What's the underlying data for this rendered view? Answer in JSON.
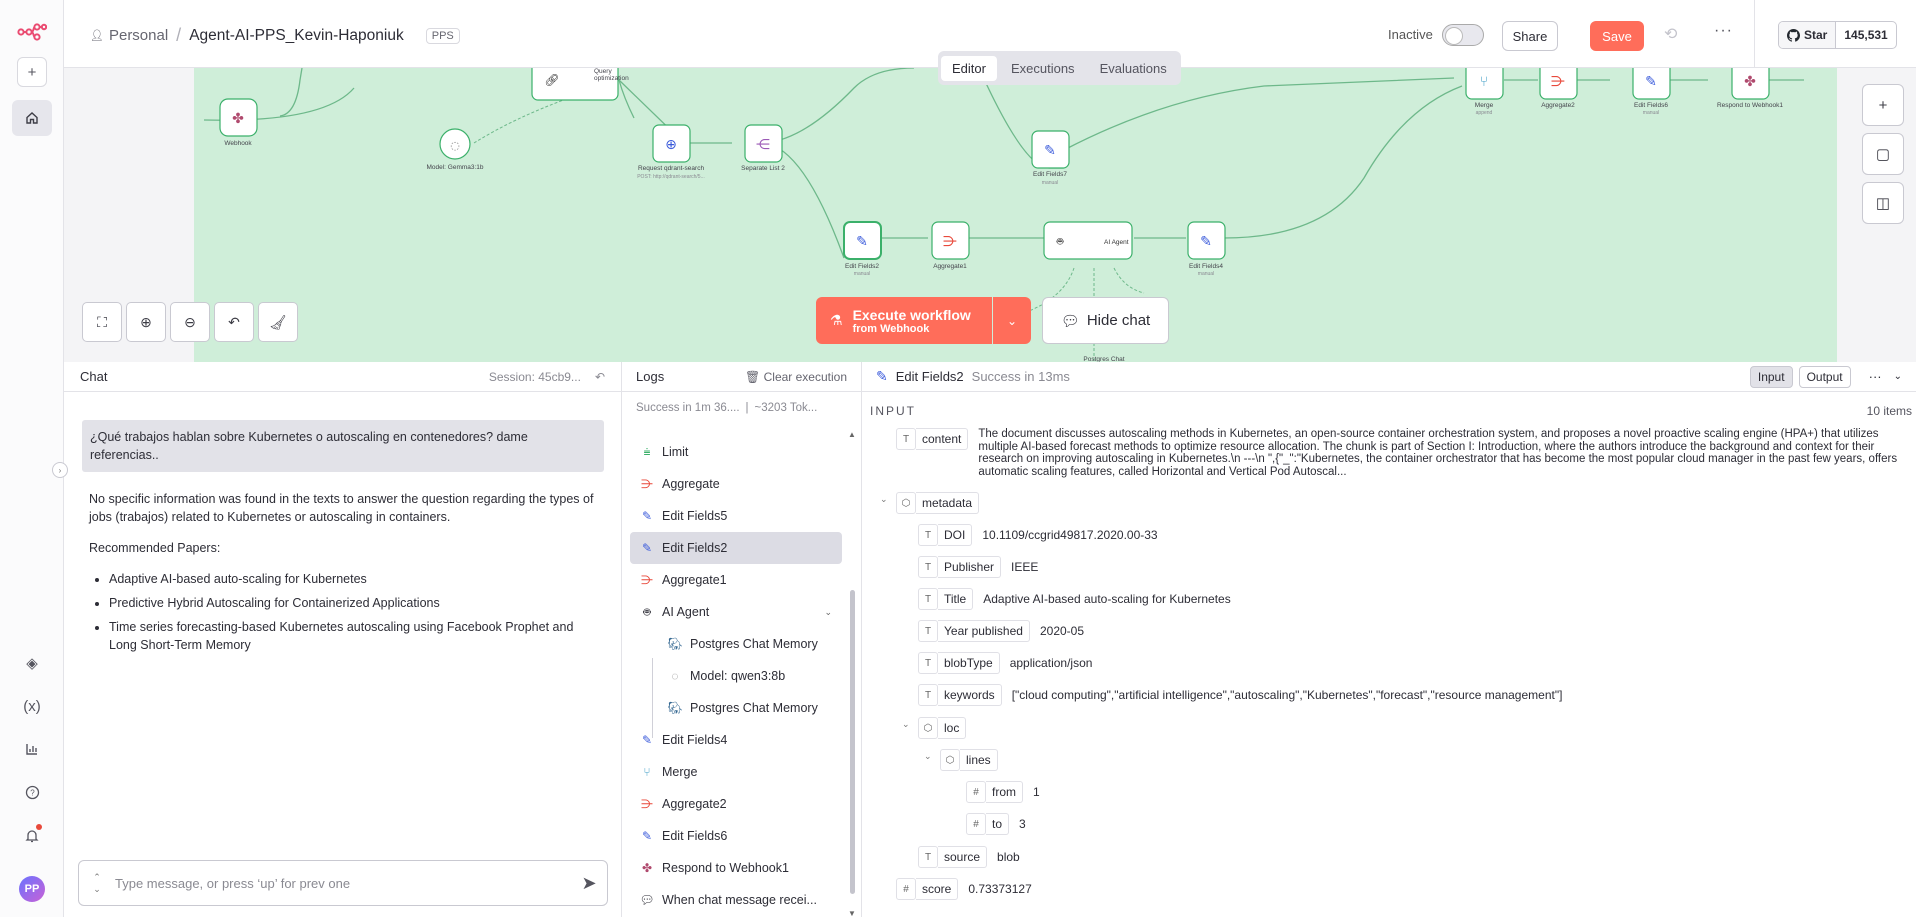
{
  "header": {
    "workspace": "Personal",
    "workflow_name": "Agent-AI-PPS_Kevin-Haponiuk",
    "tag": "PPS",
    "active_label": "Inactive",
    "share_label": "Share",
    "save_label": "Save",
    "github_star_label": "Star",
    "github_star_count": "145,531"
  },
  "canvas": {
    "tabs": [
      "Editor",
      "Executions",
      "Evaluations"
    ],
    "active_tab": "Editor",
    "execute_label": "Execute workflow",
    "execute_sub": "from Webhook",
    "hide_chat_label": "Hide chat",
    "nodes": {
      "webhook": "Webhook",
      "query_opt": "Query optimization",
      "model_gemma": "Model: Gemma3:1b",
      "request_qdrant": "Request qdrant-search",
      "request_qdrant_sub": "POST: http://qdrant-search/5...",
      "separate_list": "Separate List 2",
      "edit_fields7": "Edit Fields7",
      "edit_fields7_sub": "manual",
      "edit_fields2": "Edit Fields2",
      "edit_fields2_sub": "manual",
      "aggregate1": "Aggregate1",
      "ai_agent": "AI Agent",
      "edit_fields4": "Edit Fields4",
      "edit_fields4_sub": "manual",
      "merge": "Merge",
      "merge_sub": "append",
      "aggregate2": "Aggregate2",
      "edit_fields6": "Edit Fields6",
      "edit_fields6_sub": "manual",
      "respond_webhook": "Respond to Webhook1",
      "postgres_chat": "Postgres Chat"
    }
  },
  "chat": {
    "title": "Chat",
    "session": "Session: 45cb9...",
    "user_message": "¿Qué trabajos hablan sobre Kubernetes o autoscaling en contenedores? dame referencias..",
    "bot_intro": "No specific information was found in the texts to answer the question regarding the types of jobs (trabajos) related to Kubernetes or autoscaling in containers.",
    "bot_heading": "Recommended Papers:",
    "bot_items": [
      "Adaptive AI-based auto-scaling for Kubernetes",
      "Predictive Hybrid Autoscaling for Containerized Applications",
      "Time series forecasting-based Kubernetes autoscaling using Facebook Prophet and Long Short-Term Memory"
    ],
    "input_placeholder": "Type message, or press ‘up’ for prev one"
  },
  "logs": {
    "title": "Logs",
    "clear_label": "Clear execution",
    "summary_time": "Success in 1m 36....",
    "summary_tokens": "~3203 Tok...",
    "items": [
      {
        "label": "Limit",
        "icon": "limit-icon"
      },
      {
        "label": "Aggregate",
        "icon": "aggregate-icon"
      },
      {
        "label": "Edit Fields5",
        "icon": "pencil-icon"
      },
      {
        "label": "Edit Fields2",
        "icon": "pencil-icon"
      },
      {
        "label": "Aggregate1",
        "icon": "aggregate-icon"
      },
      {
        "label": "AI Agent",
        "icon": "robot-icon"
      },
      {
        "label": "Postgres Chat Memory",
        "icon": "postgres-icon"
      },
      {
        "label": "Model: qwen3:8b",
        "icon": "ollama-icon"
      },
      {
        "label": "Postgres Chat Memory",
        "icon": "postgres-icon"
      },
      {
        "label": "Edit Fields4",
        "icon": "pencil-icon"
      },
      {
        "label": "Merge",
        "icon": "merge-icon"
      },
      {
        "label": "Aggregate2",
        "icon": "aggregate-icon"
      },
      {
        "label": "Edit Fields6",
        "icon": "pencil-icon"
      },
      {
        "label": "Respond to Webhook1",
        "icon": "webhook-icon"
      },
      {
        "label": "When chat message recei...",
        "icon": "chat-icon"
      }
    ]
  },
  "details": {
    "node_name": "Edit Fields2",
    "status": "Success in 13ms",
    "tabs": [
      "Input",
      "Output"
    ],
    "section_label": "INPUT",
    "items_count": "10 items",
    "content_key": "content",
    "content_value": "The document discusses autoscaling methods in Kubernetes, an open-source container orchestration system, and proposes a novel proactive scaling engine (HPA+) that utilizes multiple AI-based forecast methods to optimize resource allocation. The chunk is part of Section I: Introduction, where the authors introduce the background and context for their research on improving autoscaling in Kubernetes.\\n ---\\n \",{\"_\":\"Kubernetes, the container orchestrator that has become the most popular cloud manager in the past few years, offers automatic scaling features, called Horizontal and Vertical Pod Autoscal...",
    "metadata_key": "metadata",
    "fields": {
      "doi_key": "DOI",
      "doi": "10.1109/ccgrid49817.2020.00-33",
      "publisher_key": "Publisher",
      "publisher": "IEEE",
      "title_key": "Title",
      "title": "Adaptive AI-based auto-scaling for Kubernetes",
      "year_key": "Year published",
      "year": "2020-05",
      "blob_key": "blobType",
      "blob": "application/json",
      "keywords_key": "keywords",
      "keywords": "[\"cloud computing\",\"artificial intelligence\",\"autoscaling\",\"Kubernetes\",\"forecast\",\"resource management\"]",
      "loc_key": "loc",
      "lines_key": "lines",
      "from_key": "from",
      "from": "1",
      "to_key": "to",
      "to": "3",
      "source_key": "source",
      "source": "blob",
      "score_key": "score",
      "score": "0.73373127"
    }
  },
  "colors": {
    "accent": "#ff6d5a",
    "edge": "#6db88a",
    "node_border": "#3bb06a"
  }
}
